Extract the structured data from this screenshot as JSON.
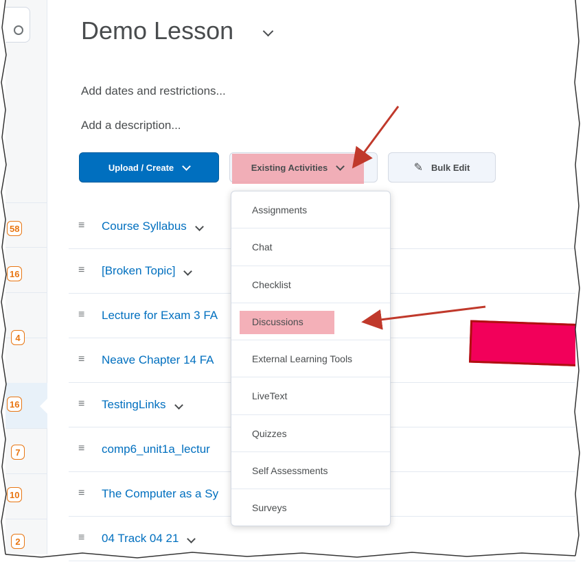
{
  "lesson": {
    "title": "Demo Lesson",
    "add_dates": "Add dates and restrictions...",
    "add_description": "Add a description..."
  },
  "toolbar": {
    "upload_create": "Upload / Create",
    "existing_activities": "Existing Activities",
    "bulk_edit": "Bulk Edit"
  },
  "dropdown": {
    "items": [
      "Assignments",
      "Chat",
      "Checklist",
      "Discussions",
      "External Learning Tools",
      "LiveText",
      "Quizzes",
      "Self Assessments",
      "Surveys"
    ],
    "highlighted": "Discussions"
  },
  "topics": [
    "Course Syllabus",
    "[Broken Topic]",
    "Lecture for Exam 3 FA",
    "Neave Chapter 14 FA",
    "TestingLinks",
    "comp6_unit1a_lectur",
    "The Computer as a Sy",
    "04 Track 04 21"
  ],
  "rail_badges": [
    "58",
    "16",
    "4",
    "16",
    "7",
    "10",
    "2"
  ],
  "colors": {
    "primary": "#006fbf",
    "badge": "#e87511",
    "highlight": "#f096a0",
    "marker": "#f2005a",
    "arrow": "#c0392b"
  }
}
